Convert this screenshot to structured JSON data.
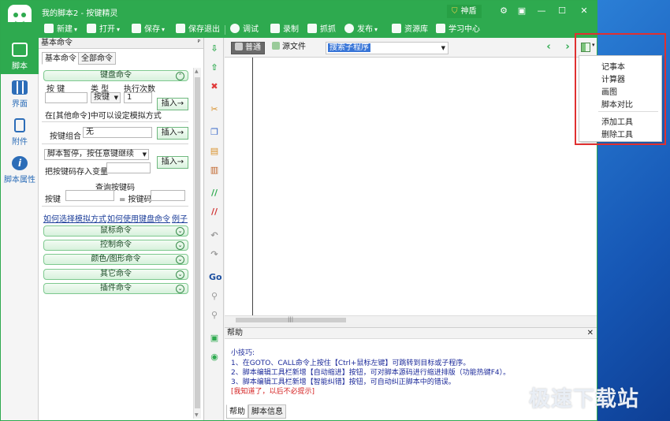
{
  "window": {
    "title": "我的脚本2 - 按键精灵",
    "vip_label": "神盾"
  },
  "toolbar": [
    {
      "label": "新建",
      "icon": "plus-icon",
      "dropdown": true
    },
    {
      "label": "打开",
      "icon": "folder-icon",
      "dropdown": true
    },
    {
      "label": "保存",
      "icon": "save-icon",
      "dropdown": true
    },
    {
      "label": "保存退出",
      "icon": "save-exit-icon"
    },
    {
      "label": "调试",
      "icon": "play-icon"
    },
    {
      "label": "录制",
      "icon": "record-icon"
    },
    {
      "label": "抓抓",
      "icon": "capture-icon"
    },
    {
      "label": "发布",
      "icon": "publish-icon",
      "dropdown": true
    },
    {
      "label": "资源库",
      "icon": "library-icon"
    },
    {
      "label": "学习中心",
      "icon": "learn-icon"
    }
  ],
  "leftnav": [
    {
      "label": "脚本",
      "icon": "script-icon",
      "active": true
    },
    {
      "label": "界面",
      "icon": "ui-grid-icon"
    },
    {
      "label": "附件",
      "icon": "attachment-icon"
    },
    {
      "label": "脚本属性",
      "icon": "info-icon"
    }
  ],
  "panel": {
    "title": "基本命令",
    "pin": "ᴾ",
    "tabs": [
      "基本命令",
      "全部命令"
    ],
    "keyboard": {
      "title": "键盘命令",
      "col_key": "按 键",
      "col_type": "类 型",
      "col_times": "执行次数",
      "type_value": "按键",
      "times_value": "1",
      "insert": "插入→",
      "note": "在[其他命令]中可以设定模拟方式",
      "combo_label": "按键组合",
      "combo_value": "无",
      "combo_insert": "插入→",
      "pause_select": "脚本暂停，按任意键继续",
      "store_label": "把按键码存入变量",
      "pause_insert": "插入→",
      "query_title": "查询按键码",
      "query_key": "按键",
      "query_code": "= 按键码"
    },
    "links": [
      "如何选择模拟方式",
      "如何使用键盘命令",
      "例子"
    ],
    "sections": [
      "鼠标命令",
      "控制命令",
      "颜色/图形命令",
      "其它命令",
      "插件命令"
    ]
  },
  "vtools": [
    {
      "icon": "arrow-down-icon",
      "glyph": "⇩",
      "color": "#2eaa4f"
    },
    {
      "icon": "arrow-up-icon",
      "glyph": "⇧",
      "color": "#2eaa4f"
    },
    {
      "icon": "delete-icon",
      "glyph": "✖",
      "color": "#e03a3a"
    },
    {
      "icon": "cut-icon",
      "glyph": "✂",
      "color": "#d8902a"
    },
    {
      "icon": "copy-icon",
      "glyph": "❐",
      "color": "#3a68c8"
    },
    {
      "icon": "paste-icon",
      "glyph": "▤",
      "color": "#d8902a"
    },
    {
      "icon": "paste-special-icon",
      "glyph": "▥",
      "color": "#c0642a"
    },
    {
      "icon": "comment-icon",
      "glyph": "//",
      "color": "#2eaa4f"
    },
    {
      "icon": "uncomment-icon",
      "glyph": "//",
      "color": "#d03030"
    },
    {
      "icon": "undo-icon",
      "glyph": "↶",
      "color": "#999999"
    },
    {
      "icon": "redo-icon",
      "glyph": "↷",
      "color": "#999999"
    },
    {
      "icon": "goto-icon",
      "glyph": "Go",
      "color": "#1c4fa0"
    },
    {
      "icon": "find-icon",
      "glyph": "⚲",
      "color": "#999999"
    },
    {
      "icon": "replace-icon",
      "glyph": "⚲",
      "color": "#999999"
    },
    {
      "icon": "syntax-check-icon",
      "glyph": "▣",
      "color": "#2eaa4f"
    },
    {
      "icon": "preview-icon",
      "glyph": "◉",
      "color": "#2eaa4f"
    }
  ],
  "editor": {
    "tabs": [
      "普通",
      "源文件"
    ],
    "subroutine_placeholder": "搜索子程序"
  },
  "help": {
    "title": "帮助",
    "tip_title": "小技巧:",
    "tips": [
      "1、在GOTO、CALL命令上按住【Ctrl+鼠标左键】可跳转到目标或子程序。",
      "2、脚本编辑工具栏新增【自动缩进】按钮，可对脚本源码进行缩进排版（功能热键F4）。",
      "3、脚本编辑工具栏新增【智能纠错】按钮，可自动纠正脚本中的错误。"
    ],
    "dismiss": "[我知道了，以后不必提示]",
    "tabs": [
      "帮助",
      "脚本信息"
    ]
  },
  "popup_menu": [
    "记事本",
    "计算器",
    "画图",
    "脚本对比",
    "添加工具",
    "删除工具"
  ],
  "watermark": "极速下载站",
  "colors": {
    "brand_green": "#2eaa4f",
    "highlight_red": "#e03030",
    "link_blue": "#1d3f9a"
  }
}
